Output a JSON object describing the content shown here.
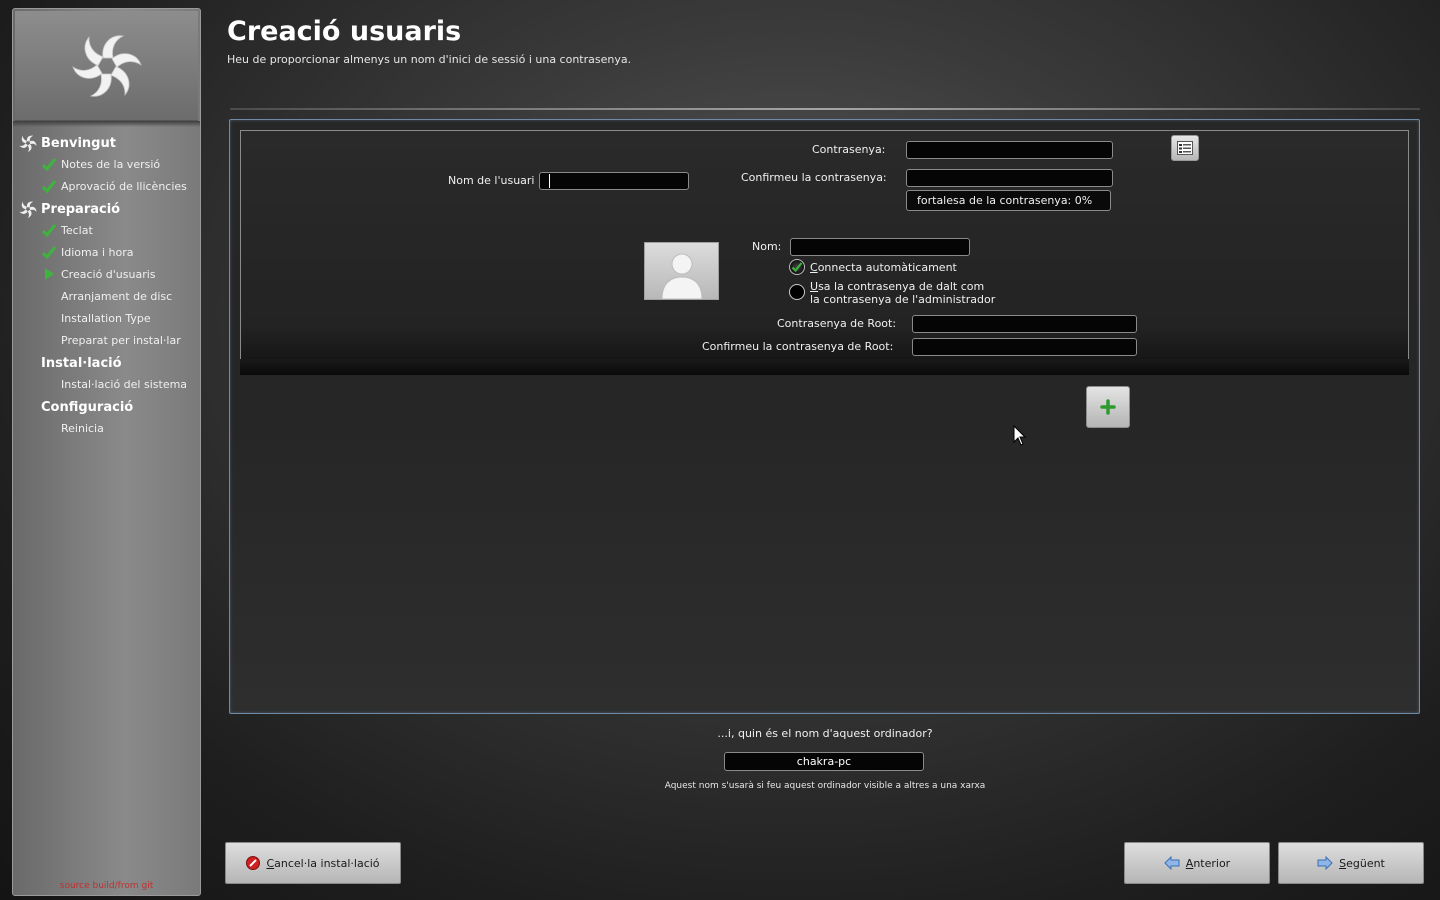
{
  "sidebar": {
    "sections": [
      {
        "label": "Benvingut"
      },
      {
        "label": "Preparació"
      },
      {
        "label": "Instal·lació"
      },
      {
        "label": "Configuració"
      }
    ],
    "items": [
      {
        "label": "Notes de la versió",
        "status": "done"
      },
      {
        "label": "Aprovació de llicències",
        "status": "done"
      },
      {
        "label": "Teclat",
        "status": "done"
      },
      {
        "label": "Idioma i hora",
        "status": "done"
      },
      {
        "label": "Creació d'usuaris",
        "status": "current"
      },
      {
        "label": "Arranjament de disc",
        "status": "pending"
      },
      {
        "label": "Installation Type",
        "status": "pending"
      },
      {
        "label": "Preparat per instal·lar",
        "status": "pending"
      },
      {
        "label": "Instal·lació del sistema",
        "status": "pending"
      },
      {
        "label": "Reinicia",
        "status": "pending"
      }
    ],
    "source_note": "source build/from git"
  },
  "header": {
    "title": "Creació usuaris",
    "subtitle": "Heu de proporcionar almenys un nom d'inici de sessió i una contrasenya."
  },
  "user_form": {
    "username_label": "Nom de l'usuari",
    "username_value": "",
    "password_label": "Contrasenya:",
    "password_value": "",
    "confirm_password_label": "Confirmeu la contrasenya:",
    "confirm_password_value": "",
    "strength_text": "fortalesa de la contrasenya: 0%",
    "name_label": "Nom:",
    "name_value": "",
    "autologin_label_prefix": "",
    "autologin_label_underlined": "C",
    "autologin_label_rest": "onnecta automàticament",
    "autologin_checked": true,
    "use_as_admin_underlined": "U",
    "use_as_admin_line1_rest": "sa la contrasenya de dalt com",
    "use_as_admin_line2": "la contrasenya de l'administrador",
    "use_as_admin_checked": false,
    "root_password_label": "Contrasenya de Root:",
    "root_password_value": "",
    "confirm_root_password_label": "Confirmeu la contrasenya de Root:",
    "confirm_root_password_value": ""
  },
  "hostname": {
    "question": "...i, quin és el nom d'aquest ordinador?",
    "value": "chakra-pc",
    "hint": "Aquest nom s'usarà si feu aquest ordinador visible a altres a una xarxa"
  },
  "buttons": {
    "cancel_underlined": "C",
    "cancel_rest": "ancel·la instal·lació",
    "back_underlined": "A",
    "back_rest": "nterior",
    "next_underlined": "S",
    "next_rest": "egüent"
  },
  "colors": {
    "panel_border": "#6d8aa6",
    "check_green": "#3db53d",
    "cancel_red": "#d02020",
    "arrow_blue": "#3a6fb8"
  }
}
